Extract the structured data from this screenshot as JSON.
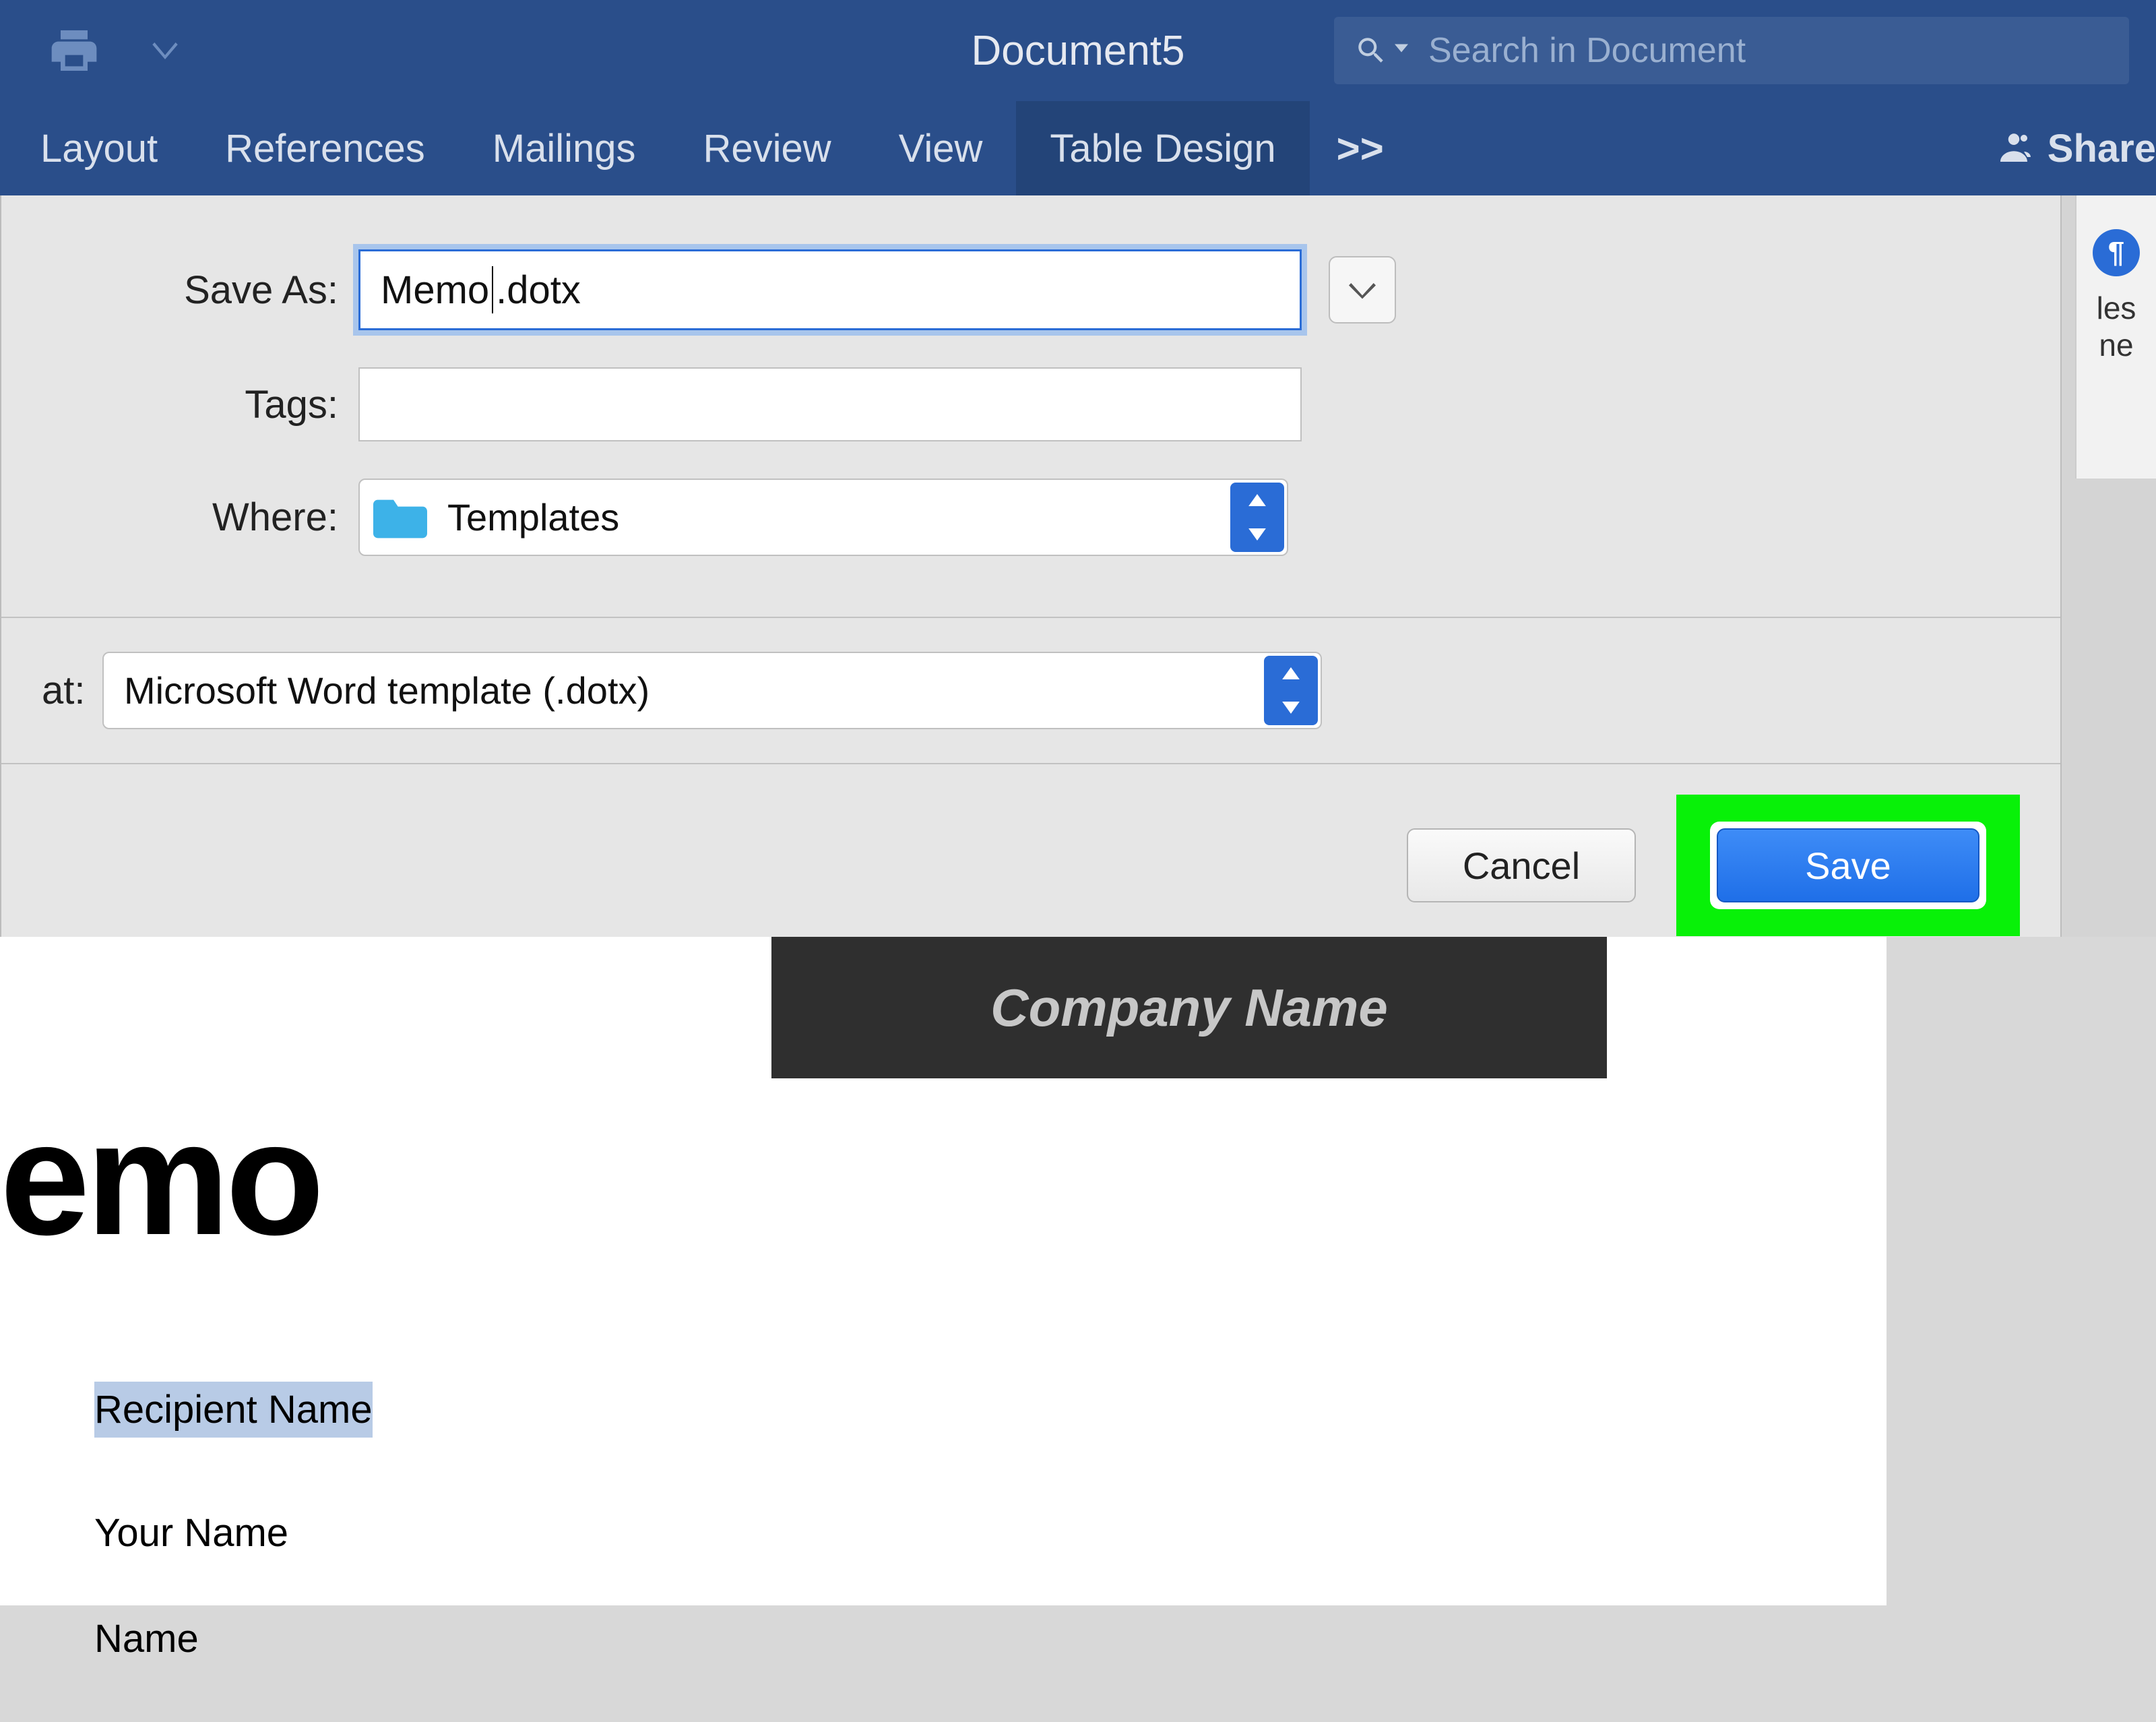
{
  "titlebar": {
    "document_title": "Document5",
    "search_placeholder": "Search in Document"
  },
  "ribbon": {
    "tabs": [
      "Layout",
      "References",
      "Mailings",
      "Review",
      "View",
      "Table Design"
    ],
    "more": ">>",
    "share": "Share"
  },
  "styles_pane": {
    "pilcrow": "¶",
    "line1": "les",
    "line2": "ne"
  },
  "dialog": {
    "save_as_label": "Save As:",
    "save_as_value_pre": "Memo",
    "save_as_value_post": ".dotx",
    "tags_label": "Tags:",
    "tags_value": "",
    "where_label": "Where:",
    "where_value": "Templates",
    "format_label": "at:",
    "format_value": "Microsoft Word template (.dotx)",
    "cancel": "Cancel",
    "save": "Save"
  },
  "document": {
    "company_banner": "Company Name",
    "title_partial": "emo",
    "fields": [
      "Recipient Name",
      "Your Name",
      "Name"
    ]
  }
}
